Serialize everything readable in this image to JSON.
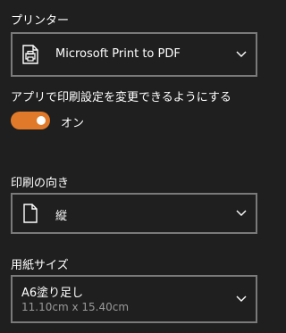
{
  "printer": {
    "section_label": "プリンター",
    "selected": "Microsoft Print to PDF",
    "icon": "printer-icon"
  },
  "app_settings": {
    "label": "アプリで印刷設定を変更できるようにする",
    "toggle_state_label": "オン",
    "toggle_on": true,
    "toggle_color": "#e07a2a"
  },
  "orientation": {
    "section_label": "印刷の向き",
    "selected": "縦",
    "icon": "page-portrait-icon"
  },
  "paper_size": {
    "section_label": "用紙サイズ",
    "selected": "A6塗り足し",
    "dimensions": "11.10cm x 15.40cm"
  }
}
